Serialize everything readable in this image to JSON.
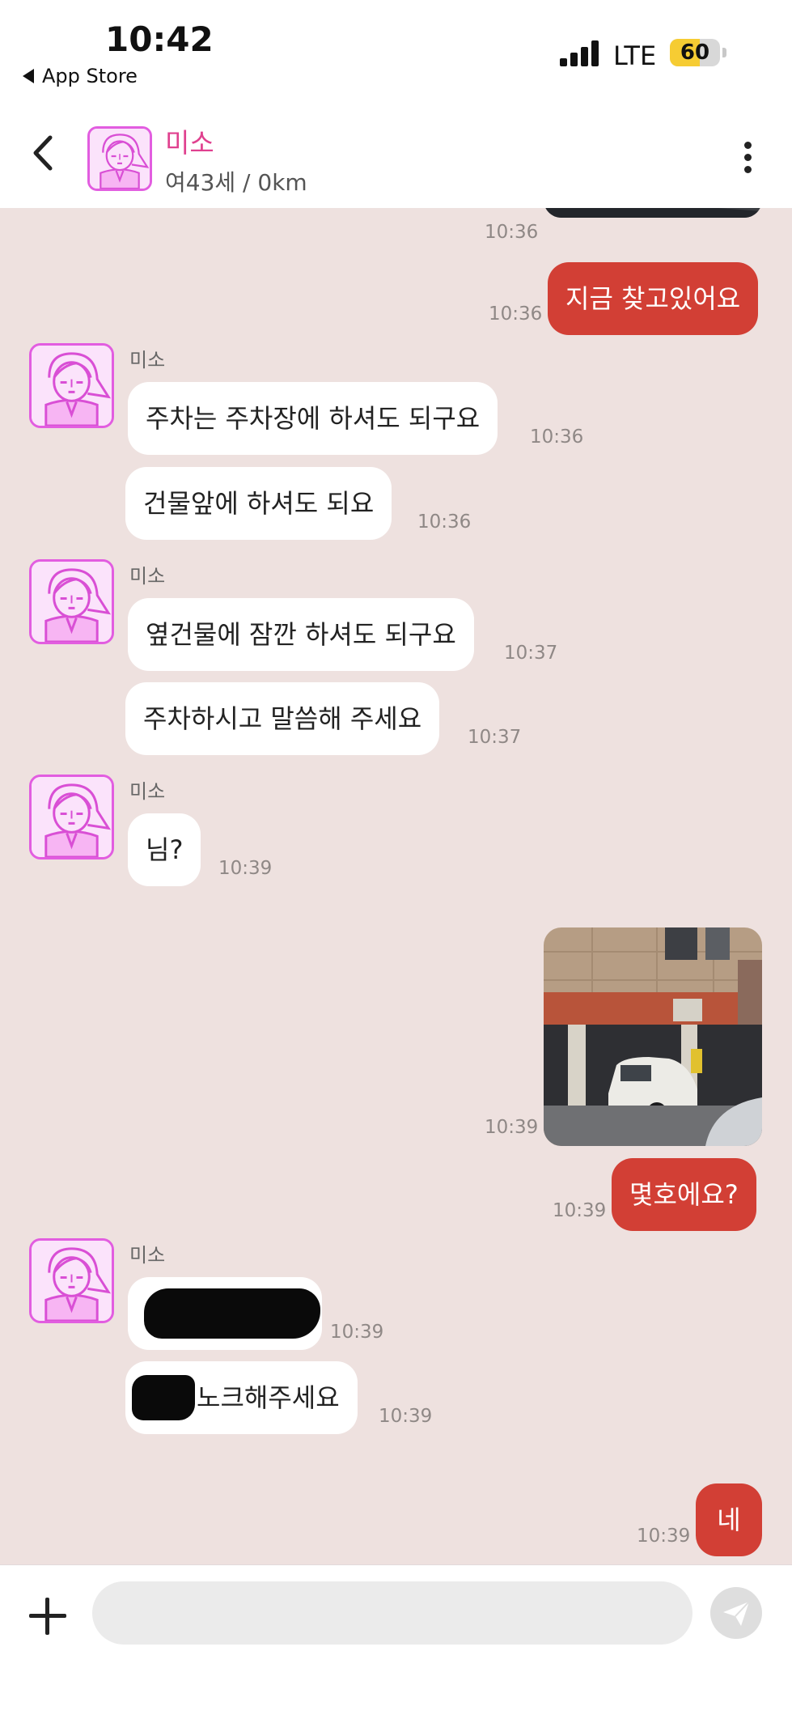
{
  "status_bar": {
    "time": "10:42",
    "back_label": "App Store",
    "network": "LTE",
    "battery": "60",
    "battery_level": 0.6
  },
  "header": {
    "name": "미소",
    "subtitle": "여43세 / 0km"
  },
  "messages": [
    {
      "id": "m1",
      "time": "10:36"
    },
    {
      "id": "m2",
      "text": "지금 찾고있어요",
      "time": "10:36"
    },
    {
      "id": "g1",
      "sender": "미소"
    },
    {
      "id": "m3",
      "text": "주차는 주차장에 하셔도 되구요",
      "time": "10:36"
    },
    {
      "id": "m4",
      "text": "건물앞에 하셔도 되요",
      "time": "10:36"
    },
    {
      "id": "g2",
      "sender": "미소"
    },
    {
      "id": "m5",
      "text": "옆건물에 잠깐 하셔도 되구요",
      "time": "10:37"
    },
    {
      "id": "m6",
      "text": "주차하시고 말씀해 주세요",
      "time": "10:37"
    },
    {
      "id": "g3",
      "sender": "미소"
    },
    {
      "id": "m7",
      "text": "님?",
      "time": "10:39"
    },
    {
      "id": "m8",
      "time": "10:39"
    },
    {
      "id": "m9",
      "text": "몇호에요?",
      "time": "10:39"
    },
    {
      "id": "g4",
      "sender": "미소"
    },
    {
      "id": "m10",
      "time": "10:39"
    },
    {
      "id": "m11",
      "text": "노크해주세요",
      "time": "10:39"
    },
    {
      "id": "m12",
      "text": "네",
      "time": "10:39"
    }
  ],
  "input": {
    "placeholder": "",
    "value": ""
  },
  "colors": {
    "accent": "#d23f35",
    "name": "#e0418f",
    "chat_bg": "#eee1df",
    "avatar_border": "#e25de0"
  },
  "icons": [
    "back-chevron-icon",
    "more-vertical-icon",
    "plus-icon",
    "send-icon"
  ]
}
